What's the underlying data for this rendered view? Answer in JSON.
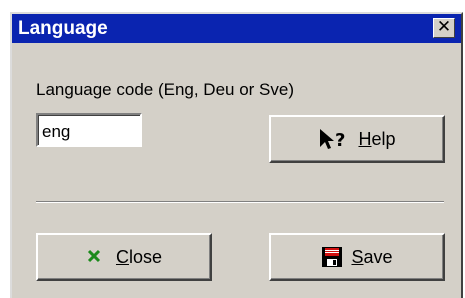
{
  "window": {
    "title": "Language",
    "close_glyph": "✕"
  },
  "form": {
    "label": "Language code (Eng, Deu or Sve)",
    "input_value": "eng"
  },
  "buttons": {
    "help": {
      "icon": "help-pointer-icon",
      "access_key": "H",
      "rest": "elp"
    },
    "close": {
      "icon": "close-x-icon",
      "access_key": "C",
      "rest": "lose"
    },
    "save": {
      "icon": "floppy-disk-icon",
      "access_key": "S",
      "rest": "ave"
    }
  },
  "colors": {
    "titlebar": "#0a24b0",
    "window_bg": "#d4d0c8",
    "close_icon_green": "#1b8a1b",
    "save_icon_red": "#d01010"
  }
}
